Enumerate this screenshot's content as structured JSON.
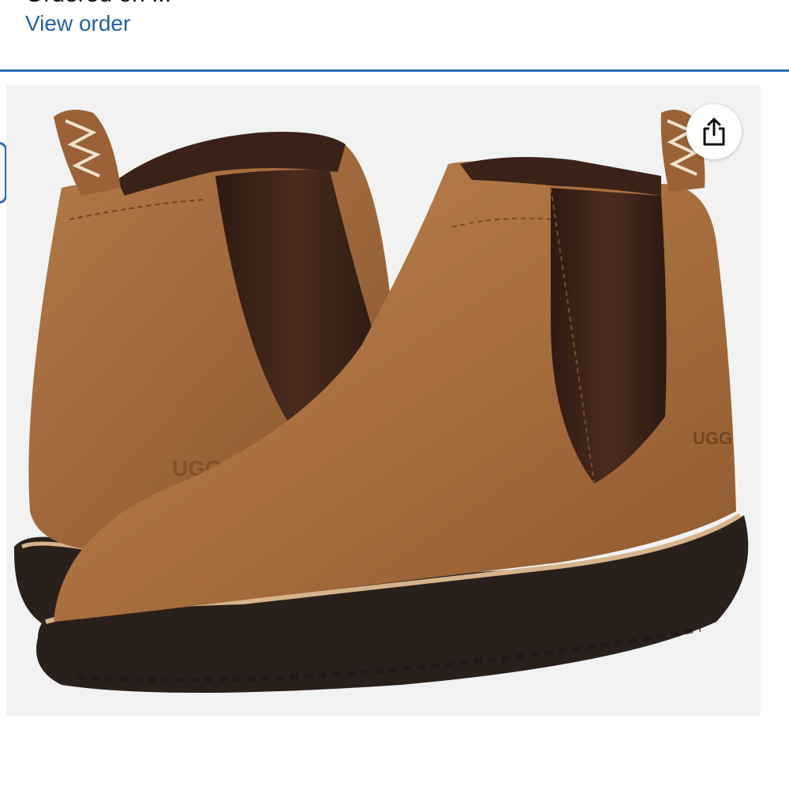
{
  "header": {
    "order_cut_text": "Ordered on ...",
    "view_order_label": "View order"
  },
  "product": {
    "image": "Chelsea boots product photo",
    "brand_logo_left": "UGG",
    "brand_logo_right": "UGG"
  },
  "actions": {
    "share_icon": "share-icon"
  },
  "colors": {
    "link": "#2162a1",
    "divider": "#2f6db8",
    "boot_tan": "#b07a49",
    "elastic_brown": "#3d2418",
    "sole_dark": "#2b211c"
  }
}
